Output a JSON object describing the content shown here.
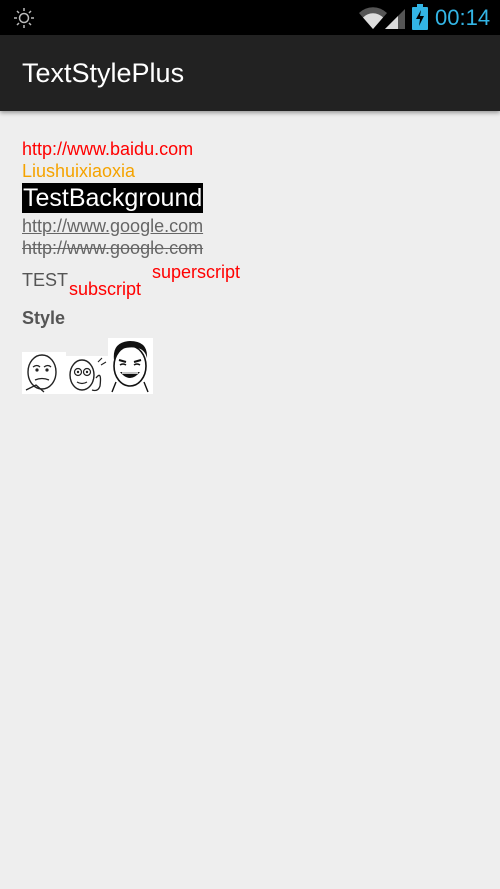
{
  "status_bar": {
    "time": "00:14",
    "icons": [
      "brightness-icon",
      "wifi-icon",
      "signal-icon",
      "battery-charging-icon"
    ],
    "clock_color": "#33b5e5"
  },
  "action_bar": {
    "title": "TextStylePlus"
  },
  "content": {
    "link_url": "http://www.baidu.com",
    "colored_text": "Liushuixiaoxia",
    "background_text": "TestBackground",
    "underline_url": "http://www.google.com",
    "strike_url": "http://www.google.com",
    "normal_text": "TEST",
    "subscript_text": "subscript",
    "superscript_text": "superscript",
    "bold_text": "Style",
    "emoticons": [
      "rage-face-thinking-icon",
      "rage-face-skeptical-icon",
      "rage-face-laughing-icon"
    ]
  },
  "colors": {
    "link": "#ff0000",
    "orange_text": "#f5a300",
    "background_highlight": "#000000",
    "action_bar": "#222222",
    "page_background": "#eeeeee"
  }
}
